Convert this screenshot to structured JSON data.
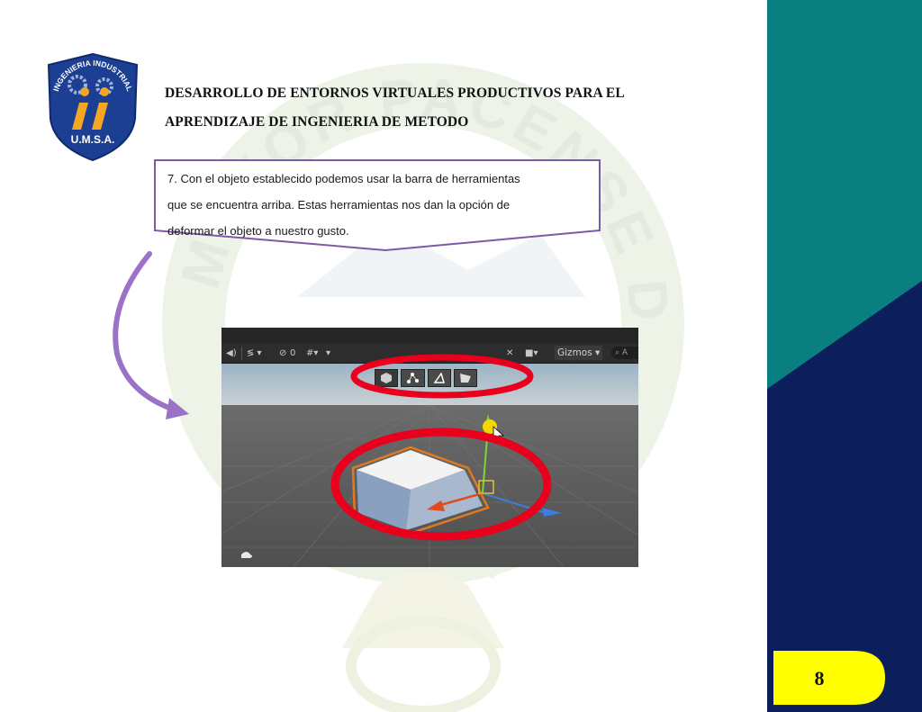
{
  "document": {
    "title_line1": "DESARROLLO DE ENTORNOS VIRTUALES PRODUCTIVOS PARA EL",
    "title_line2": "APRENDIZAJE DE INGENIERIA DE METODO",
    "page_number": "8"
  },
  "logo": {
    "arc_text": "INGENIERIA INDUSTRIAL",
    "bottom_text": "U.M.S.A."
  },
  "watermark": {
    "arc_text": "MAYOR PACENSE DE SAN ANDRES UNIVERSIDAD"
  },
  "callout": {
    "line1": "7. Con el objeto establecido podemos usar la barra de herramientas",
    "line2": "que se encuentra arriba. Estas herramientas nos dan la opción de",
    "line3": "deformar el objeto a nuestro gusto."
  },
  "screenshot": {
    "toolbar": {
      "hidden_count": "0",
      "gizmos_label": "Gizmos",
      "search_placeholder": "A"
    },
    "tools": [
      "cube-tool-icon",
      "vertex-tool-icon",
      "edge-tool-icon",
      "face-tool-icon"
    ]
  },
  "colors": {
    "teal": "#0a7f80",
    "navy": "#0c1f5c",
    "page_badge": "#ffff00",
    "callout_border": "#7b5aa6",
    "arrow": "#9b72c8",
    "highlight": "#e8001c"
  }
}
